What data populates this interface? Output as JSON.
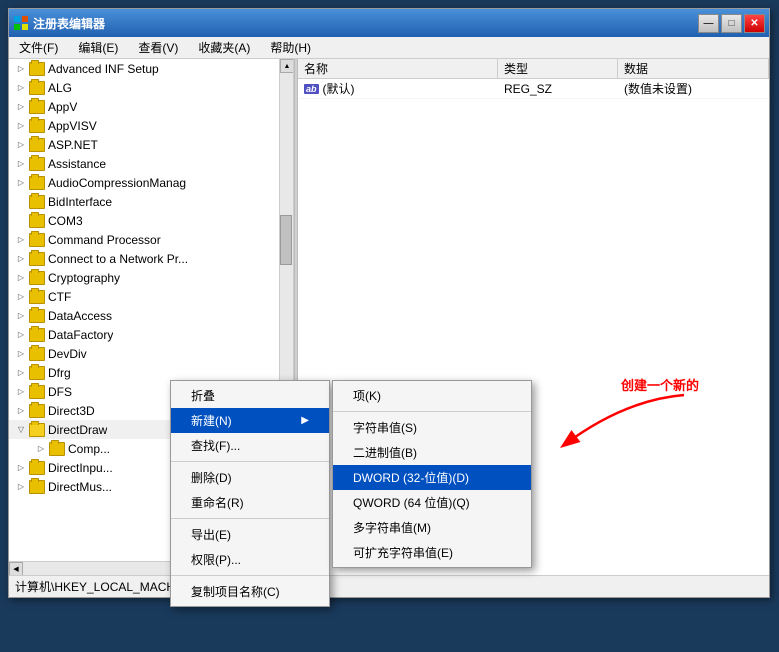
{
  "window": {
    "title": "注册表编辑器",
    "icon": "regedit"
  },
  "titlebar": {
    "buttons": {
      "minimize": "—",
      "maximize": "□",
      "close": "✕"
    }
  },
  "menubar": {
    "items": [
      {
        "id": "file",
        "label": "文件(F)"
      },
      {
        "id": "edit",
        "label": "编辑(E)"
      },
      {
        "id": "view",
        "label": "查看(V)"
      },
      {
        "id": "favorites",
        "label": "收藏夹(A)"
      },
      {
        "id": "help",
        "label": "帮助(H)"
      }
    ]
  },
  "tree": {
    "items": [
      {
        "id": "advanced-inf",
        "label": "Advanced INF Setup",
        "level": 1,
        "expanded": false
      },
      {
        "id": "alg",
        "label": "ALG",
        "level": 1,
        "expanded": false
      },
      {
        "id": "appv",
        "label": "AppV",
        "level": 1,
        "expanded": false
      },
      {
        "id": "appvisv",
        "label": "AppVISV",
        "level": 1,
        "expanded": false
      },
      {
        "id": "aspnet",
        "label": "ASP.NET",
        "level": 1,
        "expanded": false
      },
      {
        "id": "assistance",
        "label": "Assistance",
        "level": 1,
        "expanded": false
      },
      {
        "id": "audiocompression",
        "label": "AudioCompressionManag",
        "level": 1,
        "expanded": false
      },
      {
        "id": "bidinterface",
        "label": "BidInterface",
        "level": 1,
        "expanded": false
      },
      {
        "id": "com3",
        "label": "COM3",
        "level": 1,
        "expanded": false
      },
      {
        "id": "commandprocessor",
        "label": "Command Processor",
        "level": 1,
        "expanded": false
      },
      {
        "id": "connectnetwork",
        "label": "Connect to a Network Pr...",
        "level": 1,
        "expanded": false
      },
      {
        "id": "cryptography",
        "label": "Cryptography",
        "level": 1,
        "expanded": false
      },
      {
        "id": "ctf",
        "label": "CTF",
        "level": 1,
        "expanded": false
      },
      {
        "id": "dataaccess",
        "label": "DataAccess",
        "level": 1,
        "expanded": false
      },
      {
        "id": "datafactory",
        "label": "DataFactory",
        "level": 1,
        "expanded": false
      },
      {
        "id": "devdiv",
        "label": "DevDiv",
        "level": 1,
        "expanded": false
      },
      {
        "id": "dfrg",
        "label": "Dfrg",
        "level": 1,
        "expanded": false
      },
      {
        "id": "dfs",
        "label": "DFS",
        "level": 1,
        "expanded": false
      },
      {
        "id": "direct3d",
        "label": "Direct3D",
        "level": 1,
        "expanded": false
      },
      {
        "id": "directdraw",
        "label": "DirectDraw",
        "level": 1,
        "expanded": true,
        "selected": true
      },
      {
        "id": "comp",
        "label": "Comp...",
        "level": 2,
        "expanded": false
      },
      {
        "id": "directinput",
        "label": "DirectInpu...",
        "level": 1,
        "expanded": false
      },
      {
        "id": "directmus",
        "label": "DirectMus...",
        "level": 1,
        "expanded": false
      }
    ]
  },
  "table": {
    "headers": [
      "名称",
      "类型",
      "数据"
    ],
    "rows": [
      {
        "name": "(默认)",
        "type": "REG_SZ",
        "data": "(数值未设置)",
        "icon": "ab"
      }
    ]
  },
  "statusbar": {
    "text": "计算机\\HKEY_LOCAL_MACHINE"
  },
  "contextmenu": {
    "items": [
      {
        "id": "fold",
        "label": "折叠",
        "arrow": false
      },
      {
        "id": "new",
        "label": "新建(N)",
        "arrow": true,
        "highlighted": true
      },
      {
        "id": "find",
        "label": "查找(F)..."
      },
      {
        "id": "sep1",
        "type": "separator"
      },
      {
        "id": "delete",
        "label": "删除(D)"
      },
      {
        "id": "rename",
        "label": "重命名(R)"
      },
      {
        "id": "sep2",
        "type": "separator"
      },
      {
        "id": "export",
        "label": "导出(E)"
      },
      {
        "id": "permissions",
        "label": "权限(P)..."
      },
      {
        "id": "sep3",
        "type": "separator"
      },
      {
        "id": "copyname",
        "label": "复制项目名称(C)"
      }
    ]
  },
  "submenu": {
    "items": [
      {
        "id": "xiang",
        "label": "项(K)"
      },
      {
        "id": "sep1",
        "type": "separator"
      },
      {
        "id": "string",
        "label": "字符串值(S)"
      },
      {
        "id": "binary",
        "label": "二进制值(B)"
      },
      {
        "id": "dword",
        "label": "DWORD (32-位值)(D)",
        "highlighted": true
      },
      {
        "id": "qword",
        "label": "QWORD (64 位值)(Q)"
      },
      {
        "id": "multistring",
        "label": "多字符串值(M)"
      },
      {
        "id": "expandstring",
        "label": "可扩充字符串值(E)"
      }
    ]
  },
  "annotation": {
    "text": "创建一个新的"
  }
}
